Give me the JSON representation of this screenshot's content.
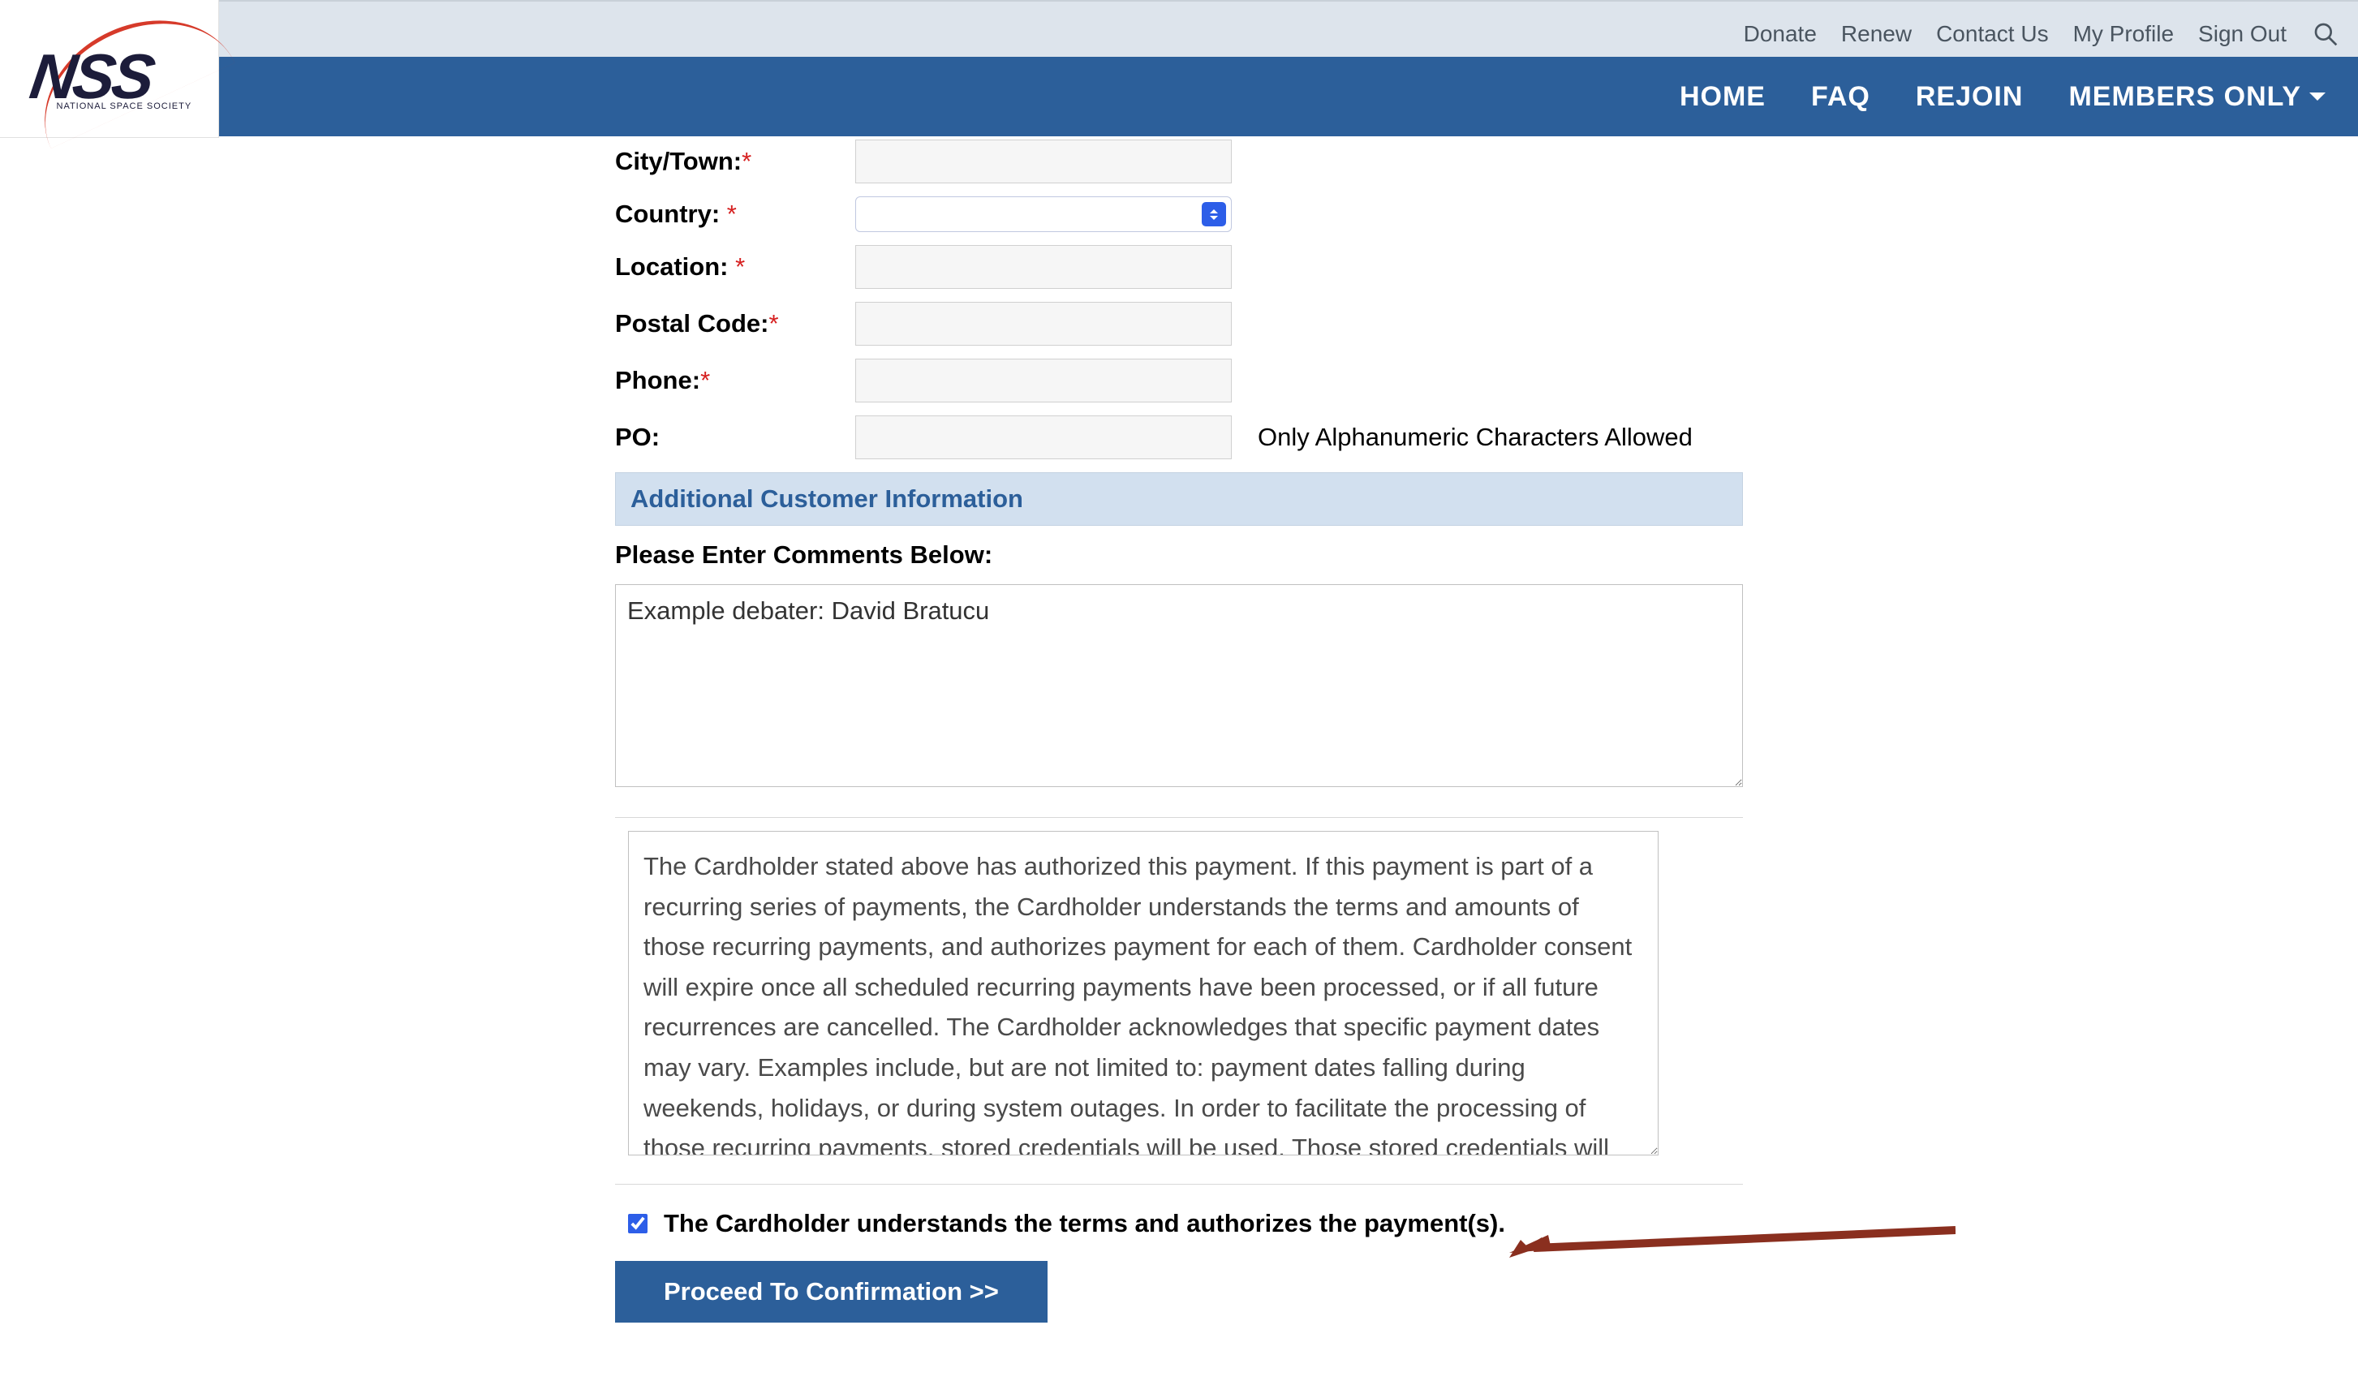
{
  "topbar": {
    "links": [
      "Donate",
      "Renew",
      "Contact Us",
      "My Profile",
      "Sign Out"
    ]
  },
  "nav": {
    "home": "HOME",
    "faq": "FAQ",
    "rejoin": "REJOIN",
    "members_only": "MEMBERS ONLY"
  },
  "logo": {
    "abbr": "NSS",
    "tag": "NATIONAL SPACE SOCIETY"
  },
  "form": {
    "city_label": "City/Town:",
    "country_label": "Country:",
    "location_label": "Location:",
    "postal_label": "Postal Code:",
    "phone_label": "Phone:",
    "po_label": "PO:",
    "po_note": "Only Alphanumeric Characters Allowed",
    "required": "*"
  },
  "section": {
    "additional_header": "Additional Customer Information",
    "comments_label": "Please Enter Comments Below:",
    "comments_value": "Example debater: David Bratucu"
  },
  "terms_text": "The Cardholder stated above has authorized this payment. If this payment is part of a recurring series of payments, the Cardholder understands the terms and amounts of those recurring payments, and authorizes payment for each of them. Cardholder consent will expire once all scheduled recurring payments have been processed, or if all future recurrences are cancelled. The Cardholder acknowledges that specific payment dates may vary. Examples include, but are not limited to: payment dates falling during weekends, holidays, or during system outages. In order to facilitate the processing of those recurring payments, stored credentials will be used. Those stored credentials will only be used to",
  "consent_label": "The Cardholder understands the terms and authorizes the payment(s).",
  "proceed_label": "Proceed To Confirmation >>"
}
